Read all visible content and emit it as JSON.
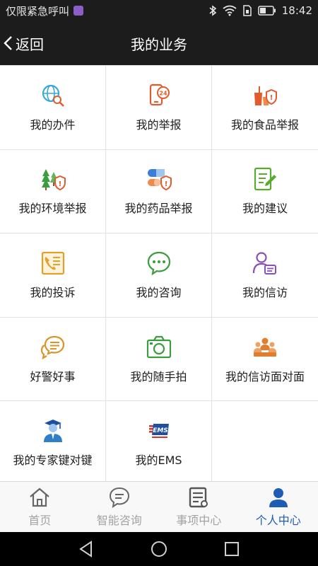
{
  "status_bar": {
    "carrier_text": "仅限紧急呼叫",
    "time": "18:42",
    "icons": [
      "notification-icon",
      "bluetooth-icon",
      "wifi-icon",
      "sim-icon",
      "battery-icon"
    ]
  },
  "header": {
    "back_label": "返回",
    "title": "我的业务"
  },
  "grid": {
    "items": [
      {
        "label": "我的办件",
        "icon": "globe-search-icon",
        "color": "#3ba7d6"
      },
      {
        "label": "我的举报",
        "icon": "phone-24-icon",
        "color": "#e25b2e"
      },
      {
        "label": "我的食品举报",
        "icon": "food-shield-icon",
        "color": "#e25b2e"
      },
      {
        "label": "我的环境举报",
        "icon": "trees-shield-icon",
        "color": "#3a9d3e"
      },
      {
        "label": "我的药品举报",
        "icon": "pill-shield-icon",
        "color": "#3b7fd6"
      },
      {
        "label": "我的建议",
        "icon": "note-pen-icon",
        "color": "#5aaa2e"
      },
      {
        "label": "我的投诉",
        "icon": "complaint-phone-icon",
        "color": "#e0a22a"
      },
      {
        "label": "我的咨询",
        "icon": "chat-bubble-icon",
        "color": "#3a9d3e"
      },
      {
        "label": "我的信访",
        "icon": "person-card-icon",
        "color": "#8a4fb8"
      },
      {
        "label": "好警好事",
        "icon": "speech-bubbles-icon",
        "color": "#d8962a"
      },
      {
        "label": "我的随手拍",
        "icon": "camera-icon",
        "color": "#3a9d3e"
      },
      {
        "label": "我的信访面对面",
        "icon": "group-meeting-icon",
        "color": "#e07d2e"
      },
      {
        "label": "我的专家键对键",
        "icon": "expert-graduate-icon",
        "color": "#2f7fc6"
      },
      {
        "label": "我的EMS",
        "icon": "ems-logo-icon",
        "color": "#1e4f9e"
      }
    ]
  },
  "tabs": [
    {
      "label": "首页",
      "icon": "home-icon",
      "active": false
    },
    {
      "label": "智能咨询",
      "icon": "chat-icon",
      "active": false
    },
    {
      "label": "事项中心",
      "icon": "list-doc-icon",
      "active": false
    },
    {
      "label": "个人中心",
      "icon": "person-icon",
      "active": true
    }
  ],
  "colors": {
    "header_bg": "#1c1c1c",
    "tab_active": "#1e5db3",
    "tab_inactive": "#a3a3a3"
  }
}
